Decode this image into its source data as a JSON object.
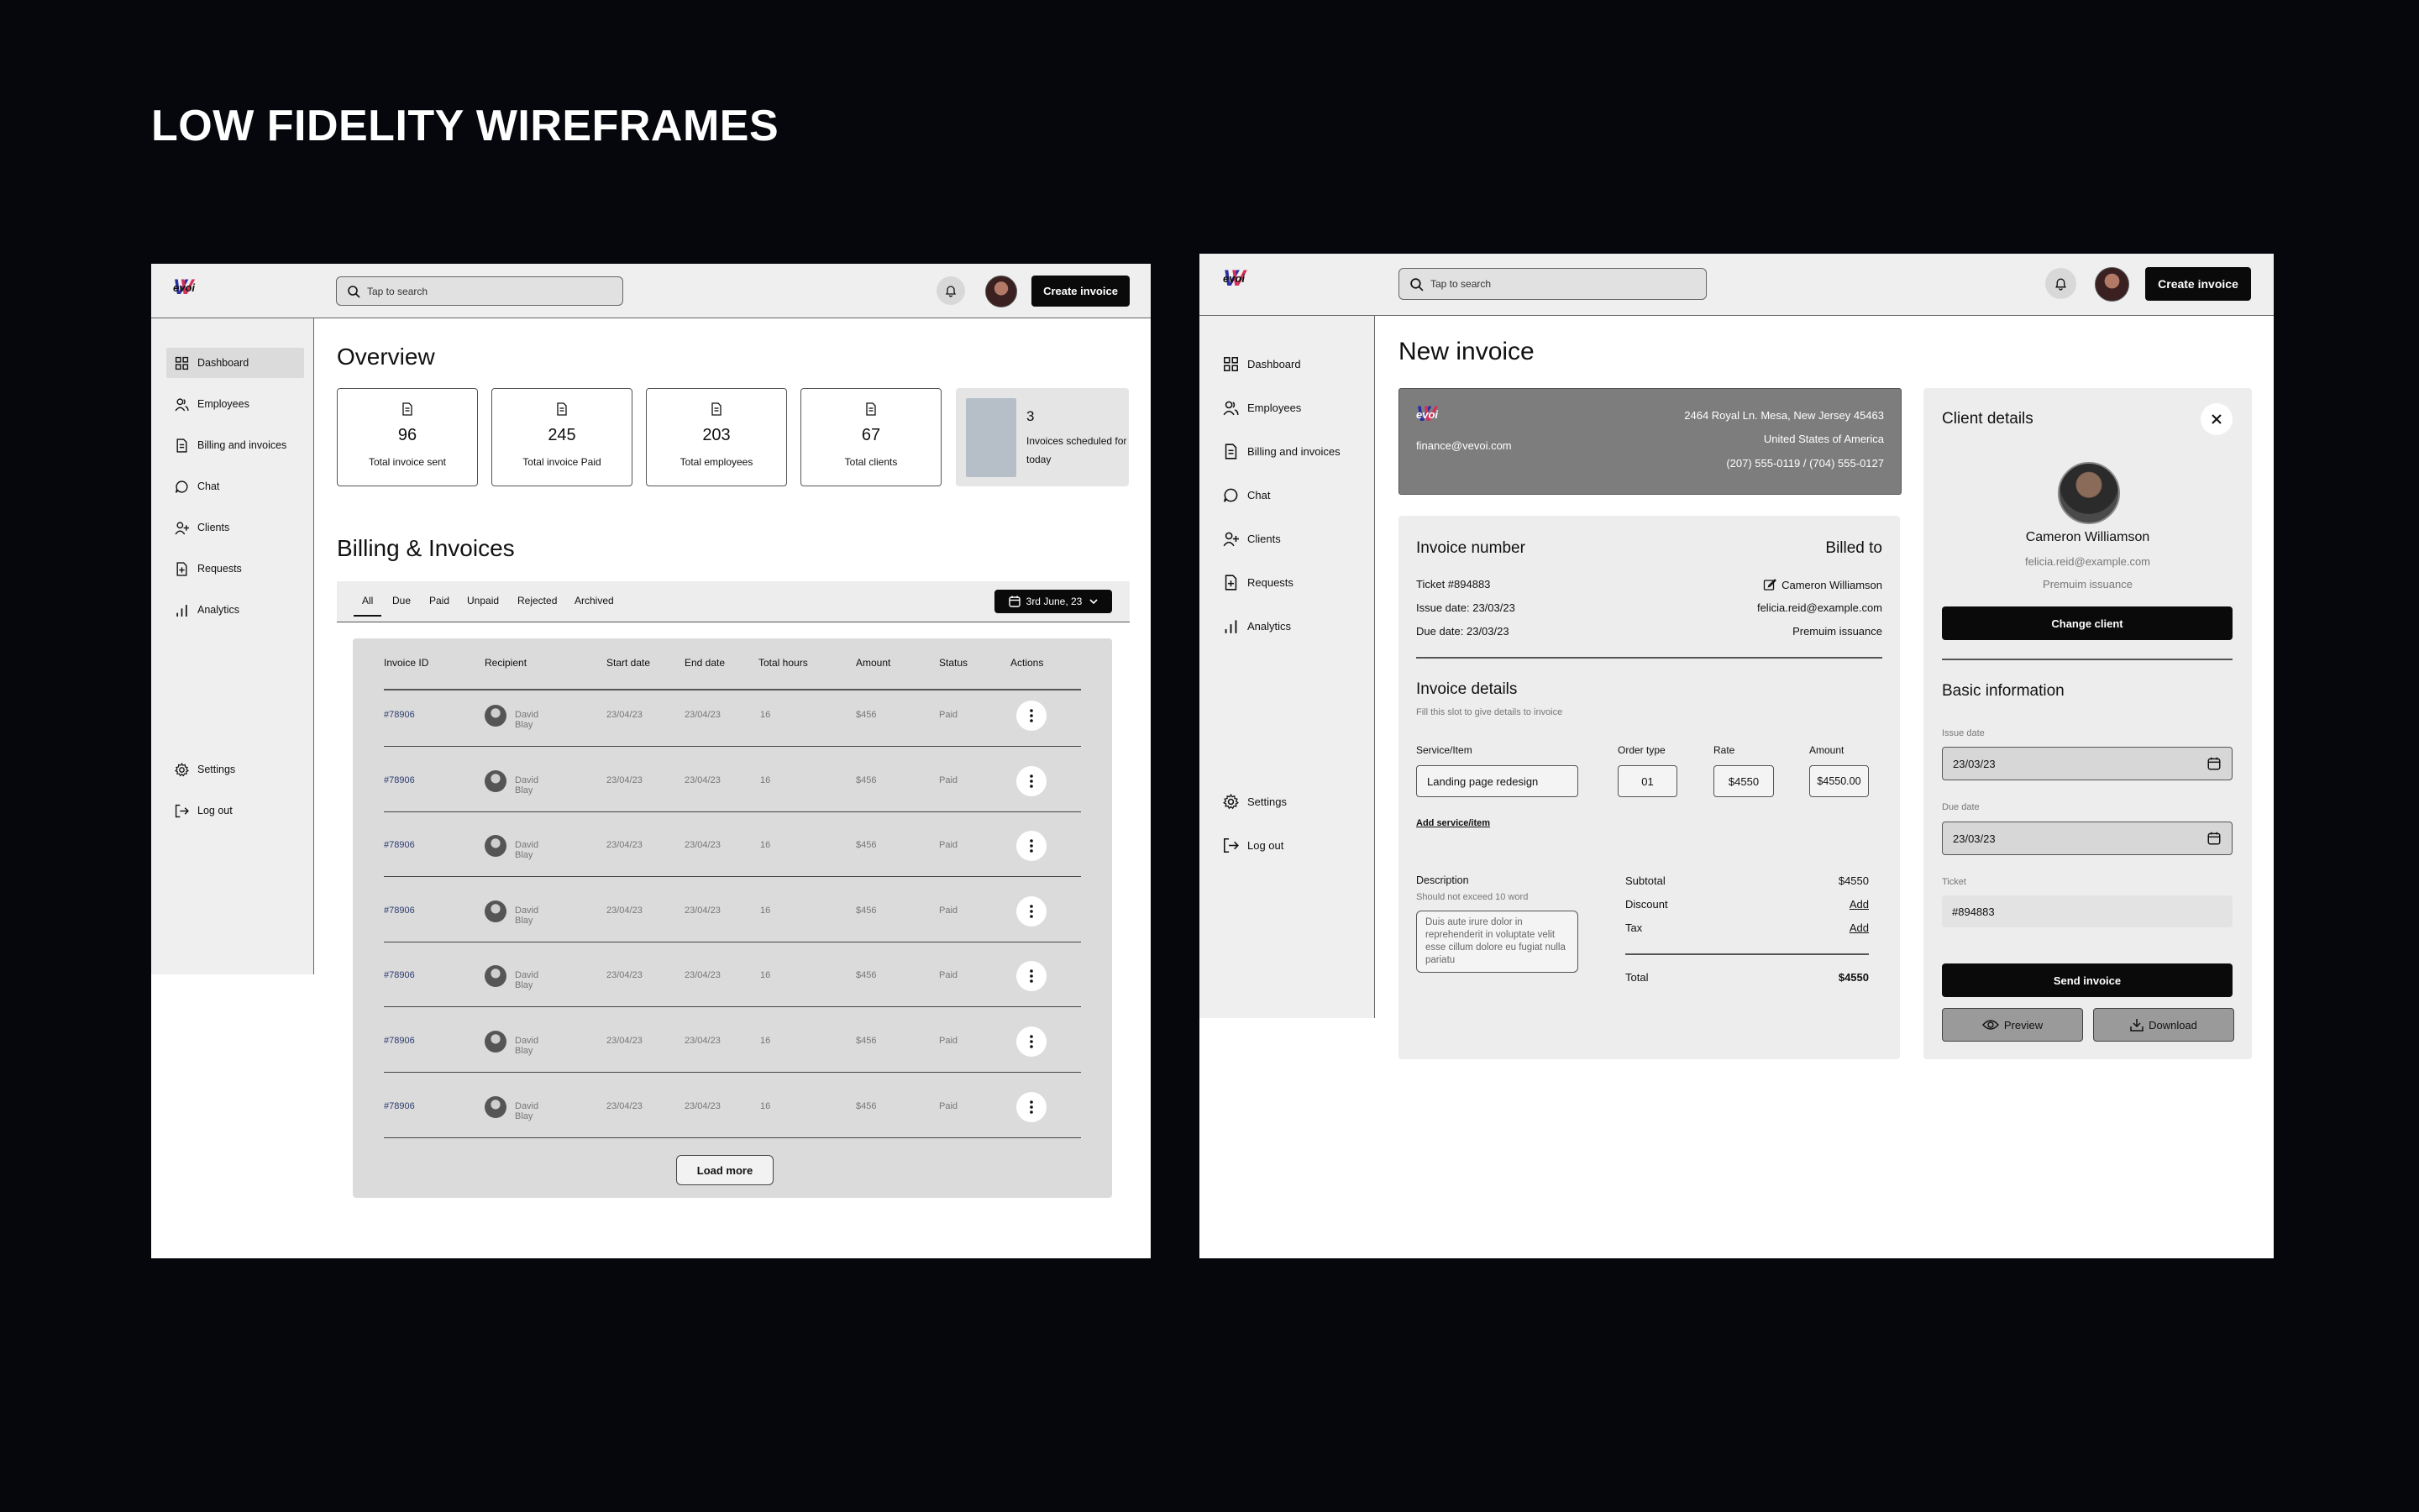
{
  "page_title": "LOW FIDELITY WIREFRAMES",
  "brand": {
    "logo_text": "evoi"
  },
  "colors": {
    "background": "#05070d",
    "frame": "#ffffff",
    "panel": "#eeedee",
    "button": "#0a0a0a",
    "accent_blue": "#2b2ea3",
    "accent_pink": "#d62f5a"
  },
  "topbar": {
    "search_placeholder": "Tap to search",
    "create_invoice": "Create invoice"
  },
  "sidebar": {
    "items": [
      {
        "label": "Dashboard",
        "icon": "grid-icon"
      },
      {
        "label": "Employees",
        "icon": "users-icon"
      },
      {
        "label": "Billing and invoices",
        "icon": "document-icon"
      },
      {
        "label": "Chat",
        "icon": "chat-icon"
      },
      {
        "label": "Clients",
        "icon": "user-plus-icon"
      },
      {
        "label": "Requests",
        "icon": "file-plus-icon"
      },
      {
        "label": "Analytics",
        "icon": "bar-chart-icon"
      }
    ],
    "settings": "Settings",
    "logout": "Log out"
  },
  "dashboard": {
    "overview_title": "Overview",
    "stats": [
      {
        "value": "96",
        "label": "Total invoice sent"
      },
      {
        "value": "245",
        "label": "Total invoice Paid"
      },
      {
        "value": "203",
        "label": "Total employees"
      },
      {
        "value": "67",
        "label": "Total clients"
      }
    ],
    "scheduled": {
      "count": "3",
      "label": "Invoices scheduled for today"
    },
    "billing_title": "Billing & Invoices",
    "tabs": [
      "All",
      "Due",
      "Paid",
      "Unpaid",
      "Rejected",
      "Archived"
    ],
    "date_filter": "3rd June, 23",
    "columns": [
      "Invoice ID",
      "Recipient",
      "Start date",
      "End date",
      "Total hours",
      "Amount",
      "Status",
      "Actions"
    ],
    "rows": [
      {
        "id": "#78906",
        "recipient": "David Blay",
        "start": "23/04/23",
        "end": "23/04/23",
        "hours": "16",
        "amount": "$456",
        "status": "Paid"
      },
      {
        "id": "#78906",
        "recipient": "David Blay",
        "start": "23/04/23",
        "end": "23/04/23",
        "hours": "16",
        "amount": "$456",
        "status": "Paid"
      },
      {
        "id": "#78906",
        "recipient": "David Blay",
        "start": "23/04/23",
        "end": "23/04/23",
        "hours": "16",
        "amount": "$456",
        "status": "Paid"
      },
      {
        "id": "#78906",
        "recipient": "David Blay",
        "start": "23/04/23",
        "end": "23/04/23",
        "hours": "16",
        "amount": "$456",
        "status": "Paid"
      },
      {
        "id": "#78906",
        "recipient": "David Blay",
        "start": "23/04/23",
        "end": "23/04/23",
        "hours": "16",
        "amount": "$456",
        "status": "Paid"
      },
      {
        "id": "#78906",
        "recipient": "David Blay",
        "start": "23/04/23",
        "end": "23/04/23",
        "hours": "16",
        "amount": "$456",
        "status": "Paid"
      },
      {
        "id": "#78906",
        "recipient": "David Blay",
        "start": "23/04/23",
        "end": "23/04/23",
        "hours": "16",
        "amount": "$456",
        "status": "Paid"
      }
    ],
    "load_more": "Load more"
  },
  "new_invoice": {
    "title": "New invoice",
    "header": {
      "address_line1": "2464 Royal Ln. Mesa, New Jersey 45463",
      "address_line2": "United States of America",
      "phones": "(207) 555-0119 / (704) 555-0127",
      "email": "finance@vevoi.com"
    },
    "invoice_number_label": "Invoice number",
    "billed_to_label": "Billed to",
    "ticket": "Ticket #894883",
    "issue_date": "Issue date: 23/03/23",
    "due_date": "Due date: 23/03/23",
    "client_name": "Cameron Williamson",
    "client_email": "felicia.reid@example.com",
    "client_plan": "Premuim issuance",
    "details_title": "Invoice details",
    "details_hint": "Fill this slot to give details to invoice",
    "service_label": "Service/Item",
    "service_value": "Landing page redesign",
    "order_label": "Order type",
    "order_value": "01",
    "rate_label": "Rate",
    "rate_value": "$4550",
    "amount_label": "Amount",
    "amount_value": "$4550.00",
    "add_service": "Add service/item",
    "description_label": "Description",
    "description_hint": "Should not exceed 10 word",
    "description_value": "Duis aute irure dolor in reprehenderit in voluptate velit esse cillum dolore eu fugiat nulla pariatu",
    "subtotal_label": "Subtotal",
    "subtotal_value": "$4550",
    "discount_label": "Discount",
    "tax_label": "Tax",
    "add_label": "Add",
    "total_label": "Total",
    "total_value": "$4550"
  },
  "client_panel": {
    "title": "Client details",
    "name": "Cameron Williamson",
    "email": "felicia.reid@example.com",
    "plan": "Premuim issuance",
    "change_client": "Change client",
    "basic_info": "Basic information",
    "issue_date_label": "Issue date",
    "issue_date_value": "23/03/23",
    "due_date_label": "Due date",
    "due_date_value": "23/03/23",
    "ticket_label": "Ticket",
    "ticket_value": "#894883",
    "send_invoice": "Send invoice",
    "preview": "Preview",
    "download": "Download"
  }
}
